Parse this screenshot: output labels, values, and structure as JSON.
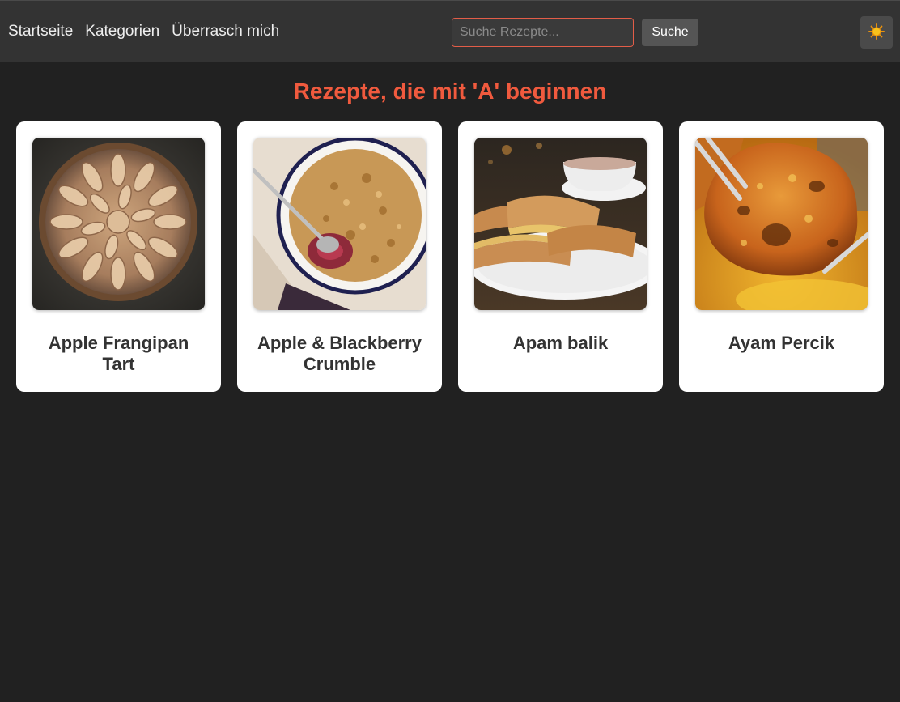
{
  "nav": {
    "links": [
      "Startseite",
      "Kategorien",
      "Überrasch mich"
    ]
  },
  "search": {
    "placeholder": "Suche Rezepte...",
    "value": "",
    "button_label": "Suche"
  },
  "theme_toggle": {
    "icon": "sun-icon"
  },
  "main": {
    "title": "Rezepte, die mit 'A' beginnen",
    "recipes": [
      {
        "name": "Apple Frangipan Tart"
      },
      {
        "name": "Apple & Blackberry Crumble"
      },
      {
        "name": "Apam balik"
      },
      {
        "name": "Ayam Percik"
      }
    ]
  },
  "colors": {
    "page_bg": "#212121",
    "navbar_bg": "#333333",
    "accent": "#f05a3e",
    "card_bg": "#ffffff"
  }
}
